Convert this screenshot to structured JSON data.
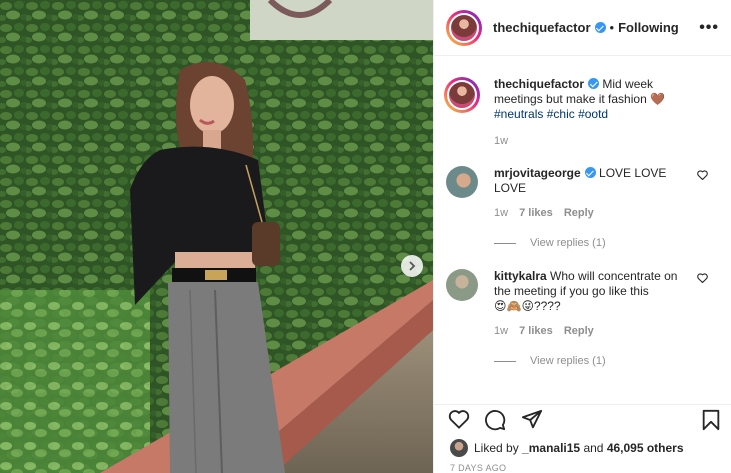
{
  "post": {
    "username": "thechiquefactor",
    "follow_dot": "•",
    "follow_status": "Following",
    "more_label": "•••",
    "caption_text": "Mid week meetings but make it fashion",
    "caption_emoji": "🤎",
    "hashtags": [
      "#neutrals",
      "#chic",
      "#ootd"
    ],
    "caption_age": "1w"
  },
  "comments": [
    {
      "username": "mrjovitageorge",
      "text": "LOVE LOVE LOVE",
      "age": "1w",
      "likes": "7 likes",
      "reply_label": "Reply",
      "view_replies": "View replies (1)"
    },
    {
      "username": "kittykalra",
      "text": "Who will concentrate on the meeting if you go like this",
      "emojis": "😍🙈😜????",
      "age": "1w",
      "likes": "7 likes",
      "reply_label": "Reply",
      "view_replies": "View replies (1)"
    }
  ],
  "likes_bar": {
    "prefix": "Liked by",
    "first_user": "_manali15",
    "connector": "and",
    "others": "46,095 others"
  },
  "timestamp": "7 DAYS AGO",
  "icons": {
    "like": "heart-icon",
    "comment": "comment-icon",
    "share": "paper-plane-icon",
    "save": "bookmark-icon",
    "next": "chevron-right-icon",
    "verified": "verified-badge-icon"
  },
  "colors": {
    "link": "#00376b",
    "verified": "#3897f0",
    "muted": "#8e8e8e"
  }
}
